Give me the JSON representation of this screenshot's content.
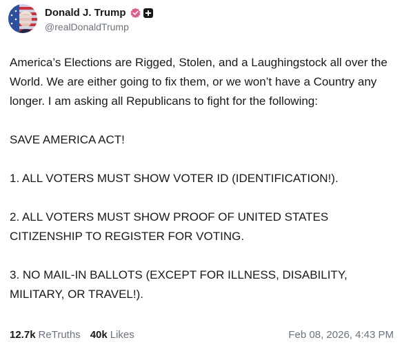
{
  "author": {
    "display_name": "Donald J. Trump",
    "handle": "@realDonaldTrump",
    "avatar_icon": "flag-portrait-avatar",
    "verified_icon": "verified-badge-icon",
    "plus_icon": "plus-badge-icon",
    "verified_color": "#e15b8b"
  },
  "post": {
    "paragraphs": [
      "America’s Elections are Rigged, Stolen, and a Laughingstock all over the World. We are either going to fix them, or we won’t have a Country any longer. I am asking all Republicans to fight for the following:",
      "SAVE AMERICA ACT!",
      "1. ALL VOTERS MUST SHOW VOTER ID (IDENTIFICATION!).",
      "2. ALL VOTERS MUST SHOW PROOF OF UNITED STATES CITIZENSHIP TO REGISTER FOR VOTING.",
      "3. NO MAIL-IN BALLOTS (EXCEPT FOR ILLNESS, DISABILITY, MILITARY, OR TRAVEL!)."
    ]
  },
  "stats": {
    "retruths_count": "12.7k",
    "retruths_label": "ReTruths",
    "likes_count": "40k",
    "likes_label": "Likes"
  },
  "timestamp": "Feb 08, 2026, 4:43 PM"
}
